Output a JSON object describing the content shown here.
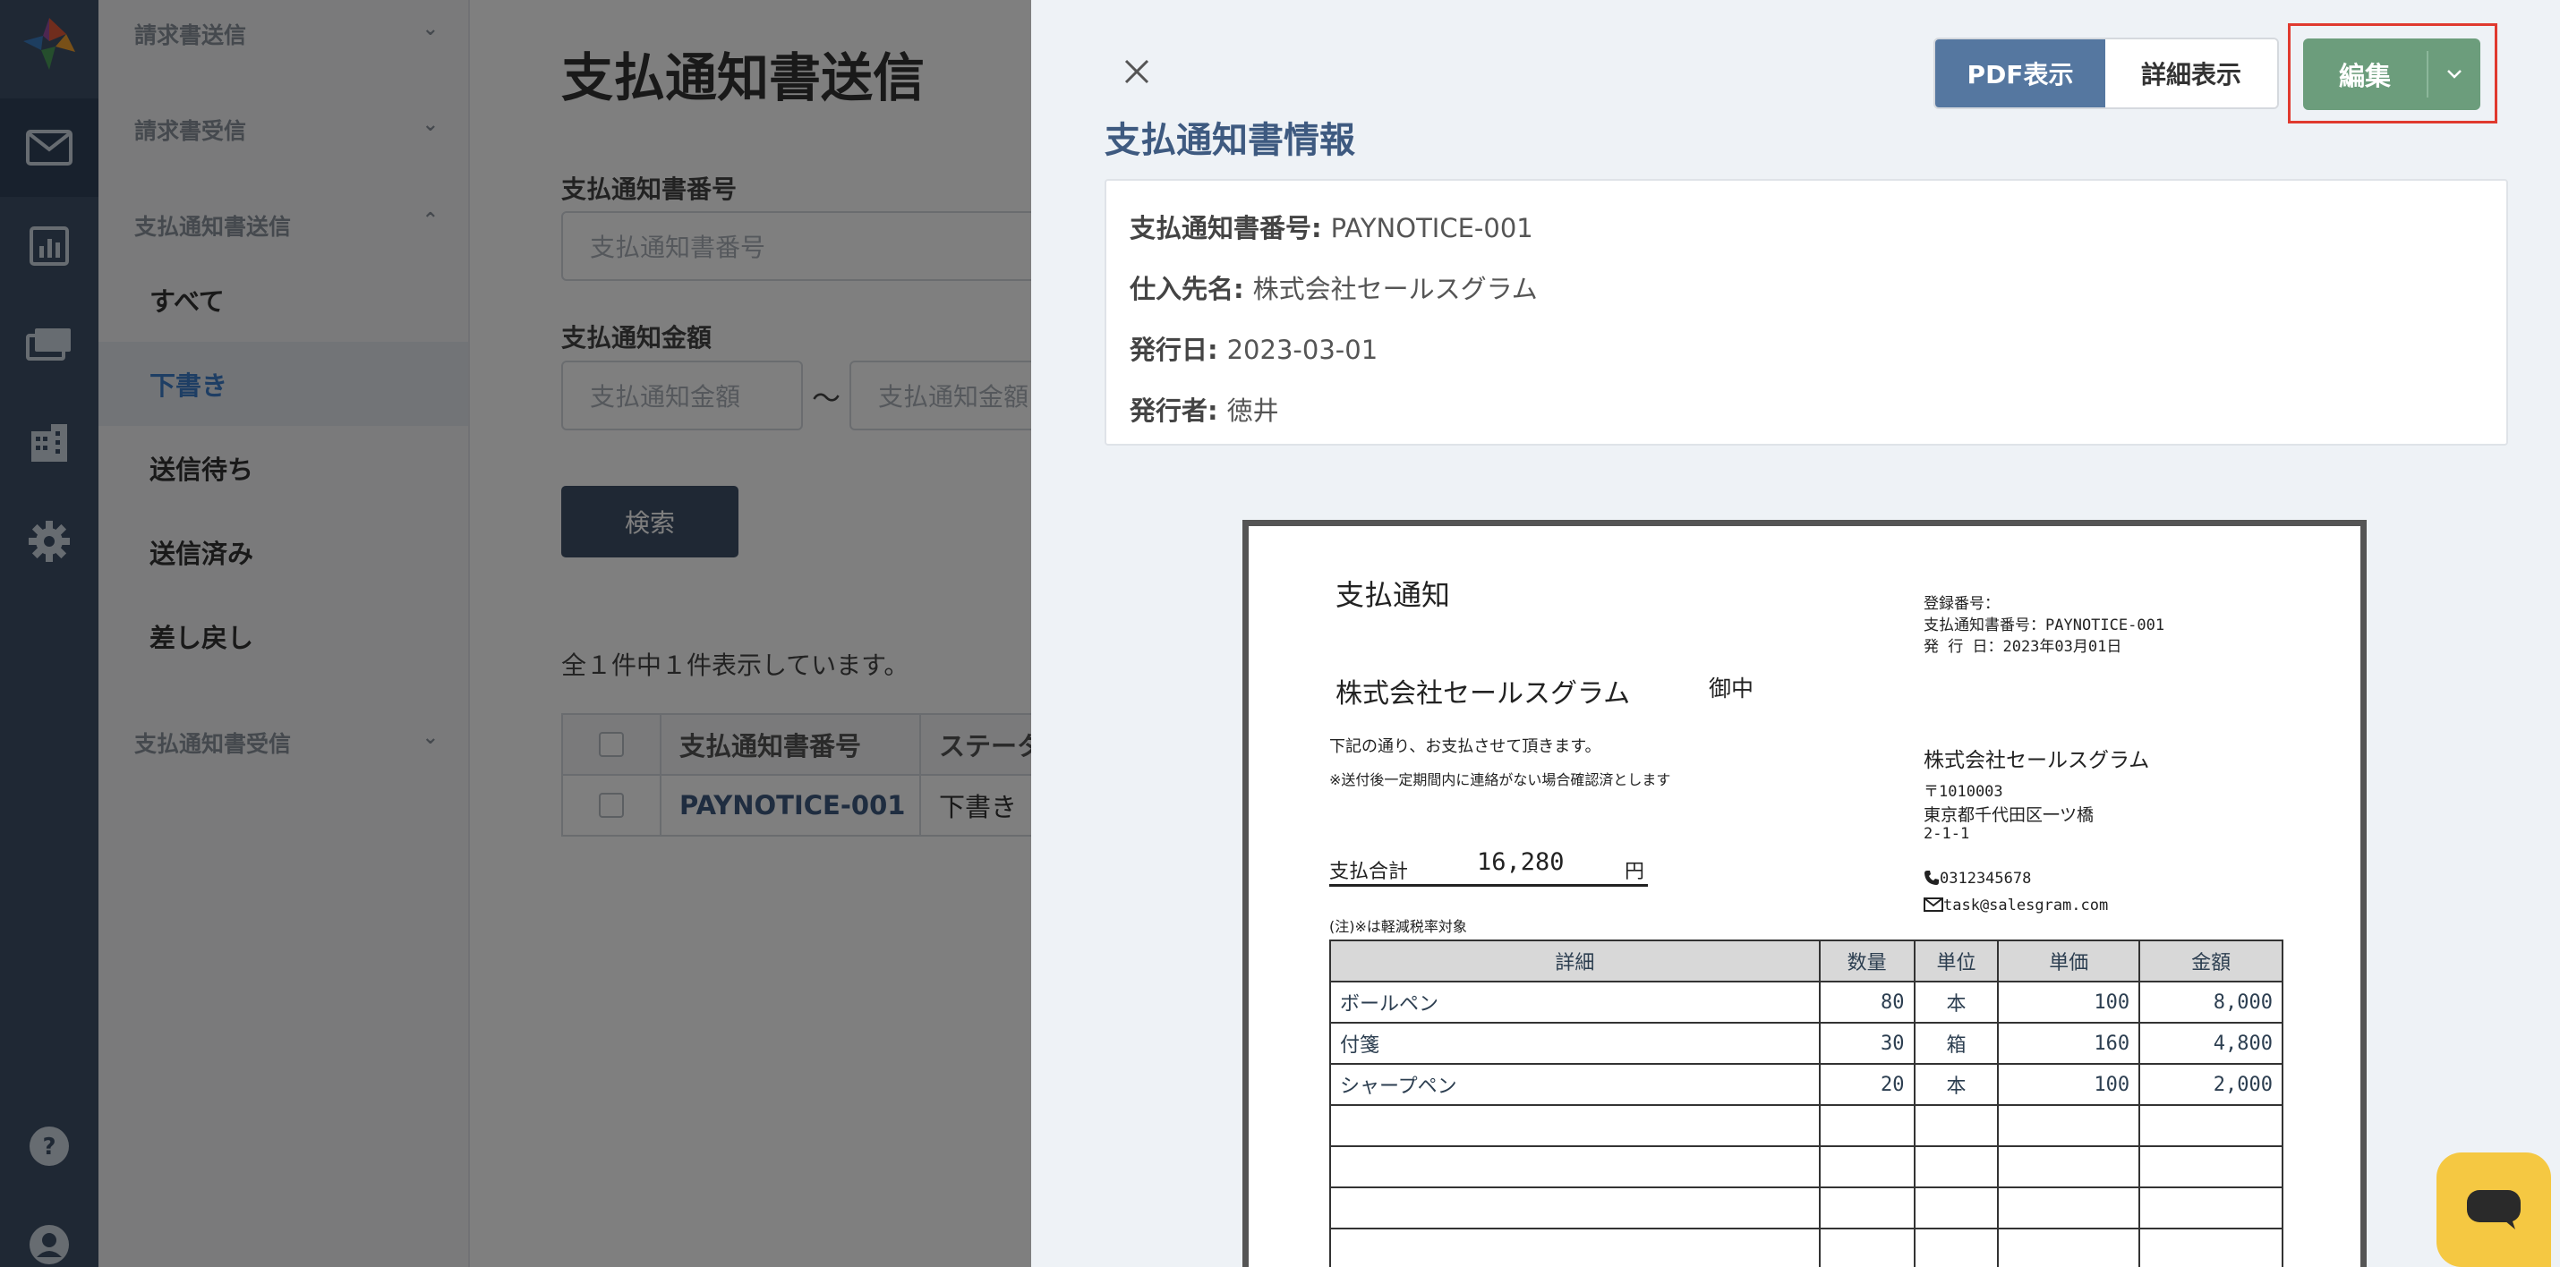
{
  "subnav": {
    "groups": [
      {
        "label": "請求書送信"
      },
      {
        "label": "請求書受信"
      },
      {
        "label": "支払通知書送信"
      },
      {
        "label": "支払通知書受信"
      }
    ],
    "items": [
      {
        "label": "すべて"
      },
      {
        "label": "下書き"
      },
      {
        "label": "送信待ち"
      },
      {
        "label": "送信済み"
      },
      {
        "label": "差し戻し"
      }
    ]
  },
  "main": {
    "title": "支払通知書送信",
    "number_label": "支払通知書番号",
    "number_placeholder": "支払通知書番号",
    "amount_label": "支払通知金額",
    "amount_min_placeholder": "支払通知金額",
    "amount_tilde": "〜",
    "amount_max_placeholder": "支払通知金額",
    "search_button": "検索",
    "result_count": "全１件中１件表示しています。",
    "table": {
      "headers": [
        "支払通知書番号",
        "ステータス"
      ],
      "header_status_visible": "ステータ",
      "rows": [
        {
          "number": "PAYNOTICE-001",
          "status": "下書き"
        }
      ]
    }
  },
  "panel": {
    "tabs": {
      "pdf": "PDF表示",
      "detail": "詳細表示"
    },
    "edit_button": "編集",
    "section_title": "支払通知書情報",
    "info": [
      {
        "label": "支払通知書番号:",
        "value": "PAYNOTICE-001"
      },
      {
        "label": "仕入先名:",
        "value": "株式会社セールスグラム"
      },
      {
        "label": "発行日:",
        "value": "2023-03-01"
      },
      {
        "label": "発行者:",
        "value": "徳井"
      }
    ],
    "document": {
      "title": "支払通知",
      "reg_no": "登録番号：",
      "doc_no": "支払通知書番号：PAYNOTICE-001",
      "issue_date": "発 行 日：2023年03月01日",
      "recipient": "株式会社セールスグラム",
      "honorific": "御中",
      "note1": "下記の通り、お支払させて頂きます。",
      "note2": "※送付後一定期間内に連絡がない場合確認済とします",
      "total_label": "支払合計",
      "total_value": "16,280",
      "total_unit": "円",
      "tax_note": "(注)※は軽減税率対象",
      "sender_name": "株式会社セールスグラム",
      "sender_zip": "〒1010003",
      "sender_addr1": "東京都千代田区一ツ橋",
      "sender_addr2": "2-1-1",
      "sender_phone": "0312345678",
      "sender_email": "task@salesgram.com",
      "columns": [
        "詳細",
        "数量",
        "単位",
        "単価",
        "金額"
      ],
      "rows": [
        {
          "detail": "ボールペン",
          "qty": "80",
          "unit": "本",
          "price": "100",
          "amount": "8,000"
        },
        {
          "detail": "付箋",
          "qty": "30",
          "unit": "箱",
          "price": "160",
          "amount": "4,800"
        },
        {
          "detail": "シャープペン",
          "qty": "20",
          "unit": "本",
          "price": "100",
          "amount": "2,000"
        }
      ]
    }
  },
  "colors": {
    "rail": "#3e5068",
    "accent_blue": "#3d7cc9",
    "pdf_tab": "#5577a0",
    "edit_green": "#6c9d7c",
    "highlight_red": "#e03a2f",
    "chat_yellow": "#f5c842"
  }
}
